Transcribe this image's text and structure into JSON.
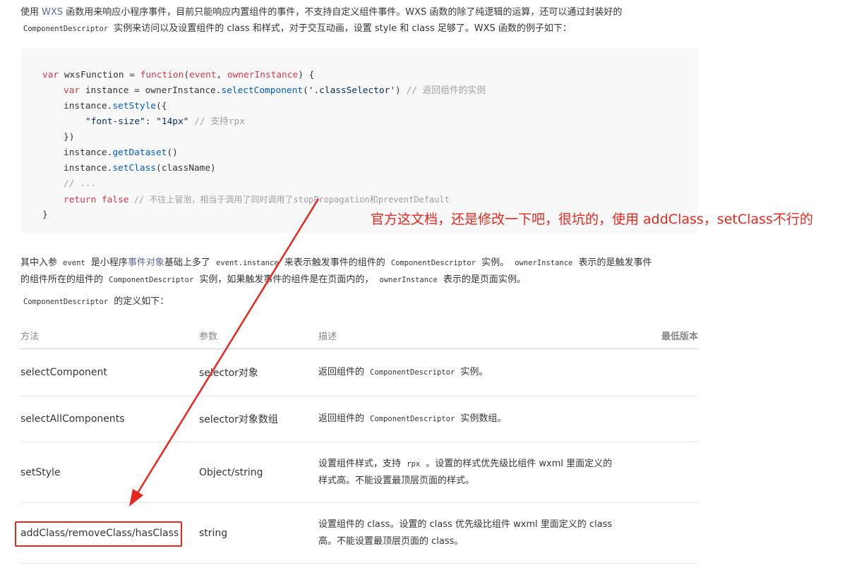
{
  "intro": {
    "text1": "使用 ",
    "link_wxs": "WXS",
    "text2": " 函数用来响应小程序事件，目前只能响应内置组件的事件，不支持自定义组件事件。WXS 函数的除了纯逻辑的运算，还可以通过封装好的",
    "code1": "ComponentDescriptor",
    "text3": " 实例来访问以及设置组件的 class 和样式，对于交互动画，设置 style 和 class 足够了。WXS 函数的例子如下："
  },
  "code": {
    "l1": {
      "kw": "var",
      "name": " wxsFunction = ",
      "fn": "function",
      "args1": "(",
      "a1": "event",
      "sep": ", ",
      "a2": "ownerInstance",
      "args2": ") {"
    },
    "l2": {
      "kw": "var",
      "mid": " instance = ownerInstance.",
      "method": "selectComponent",
      "p1": "(",
      "str": "'.classSelector'",
      "p2": ") ",
      "cm": "// 返回组件的实例"
    },
    "l3": {
      "pre": "instance.",
      "method": "setStyle",
      "post": "({"
    },
    "l4": {
      "key": "\"font-size\"",
      "colon": ": ",
      "val": "\"14px\"",
      "cm": " // 支持rpx"
    },
    "l5": {
      "text": "})"
    },
    "l6": {
      "pre": "instance.",
      "method": "getDataset",
      "post": "()"
    },
    "l7": {
      "pre": "instance.",
      "method": "setClass",
      "post": "(className)"
    },
    "l8": {
      "cm": "// ..."
    },
    "l9": {
      "kw": "return",
      "val": " false",
      "cm": " // 不往上冒泡，相当于调用了同时调用了stopPropagation和preventDefault"
    },
    "l10": {
      "text": "}"
    }
  },
  "annotation": "官方这文档，还是修改一下吧，很坑的，使用 addClass，setClass不行的",
  "para2": {
    "t1": "其中入参 ",
    "c1": "event",
    "t2": " 是小程序",
    "link": "事件对象",
    "t3": "基础上多了 ",
    "c2": "event.instance",
    "t4": " 来表示触发事件的组件的 ",
    "c3": "ComponentDescriptor",
    "t5": " 实例。 ",
    "c4": "ownerInstance",
    "t6": " 表示的是触发事件",
    "t7": "的组件所在的组件的 ",
    "c5": "ComponentDescriptor",
    "t8": " 实例，如果触发事件的组件是在页面内的， ",
    "c6": "ownerInstance",
    "t9": " 表示的是页面实例。"
  },
  "para3": {
    "code": "ComponentDescriptor",
    "text": " 的定义如下："
  },
  "table": {
    "headers": {
      "method": "方法",
      "params": "参数",
      "desc": "描述",
      "version": "最低版本"
    },
    "rows": [
      {
        "method": "selectComponent",
        "params": "selector对象",
        "d1": "返回组件的 ",
        "dc": "ComponentDescriptor",
        "d2": " 实例。",
        "d3": ""
      },
      {
        "method": "selectAllComponents",
        "params": "selector对象数组",
        "d1": "返回组件的 ",
        "dc": "ComponentDescriptor",
        "d2": " 实例数组。",
        "d3": ""
      },
      {
        "method": "setStyle",
        "params": "Object/string",
        "d1": "设置组件样式，支持 ",
        "dc": "rpx",
        "d2": " 。设置的样式优先级比组件 wxml 里面定义的",
        "d3": "样式高。不能设置最顶层页面的样式。"
      },
      {
        "method": "addClass/removeClass/hasClass",
        "params": "string",
        "d1": "设置组件的 class。设置的 class 优先级比组件 wxml 里面定义的 class",
        "dc": "",
        "d2": "",
        "d3": "高。不能设置最顶层页面的 class。"
      }
    ]
  },
  "colors": {
    "annotation_red": "#e8281f",
    "link": "#576b95",
    "code_bg": "#f8f8f8"
  }
}
